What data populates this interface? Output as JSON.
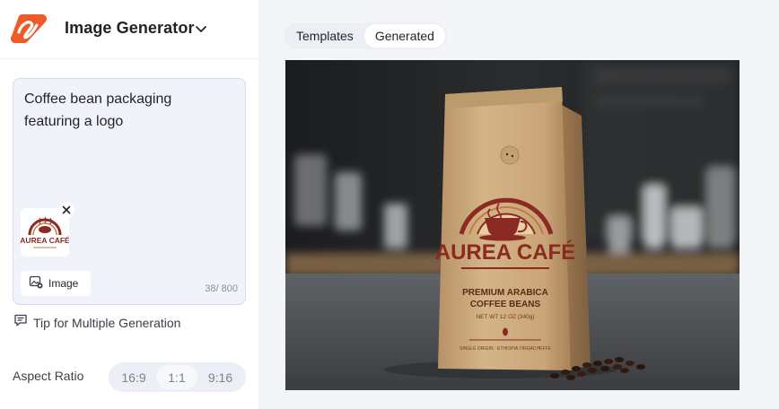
{
  "app": {
    "title": "Image Generator"
  },
  "prompt": {
    "text": "Coffee bean packaging\nfeaturing a logo",
    "char_count": "38/ 800",
    "image_button_label": "Image",
    "attachment_logo_text": "AUREA CAFÉ"
  },
  "tip": {
    "label": "Tip for Multiple Generation"
  },
  "aspect_ratio": {
    "label": "Aspect Ratio",
    "options": [
      "16:9",
      "1:1",
      "9:16"
    ],
    "selected": "1:1"
  },
  "tabs": {
    "items": [
      "Templates",
      "Generated"
    ],
    "active": "Generated"
  },
  "generated_image": {
    "brand": "AUREA CAFÉ",
    "line1": "PREMIUM ARABICA",
    "line2": "COFFEE BEANS",
    "weight": "NET WT 12 OZ (340g)",
    "origin": "SINGLE ORIGIN · ETHIOPIA YIRGACHEFFE"
  },
  "colors": {
    "accent_orange": "#f05a28",
    "brand_maroon": "#8b2a22",
    "bag_kraft": "#c9a577"
  }
}
